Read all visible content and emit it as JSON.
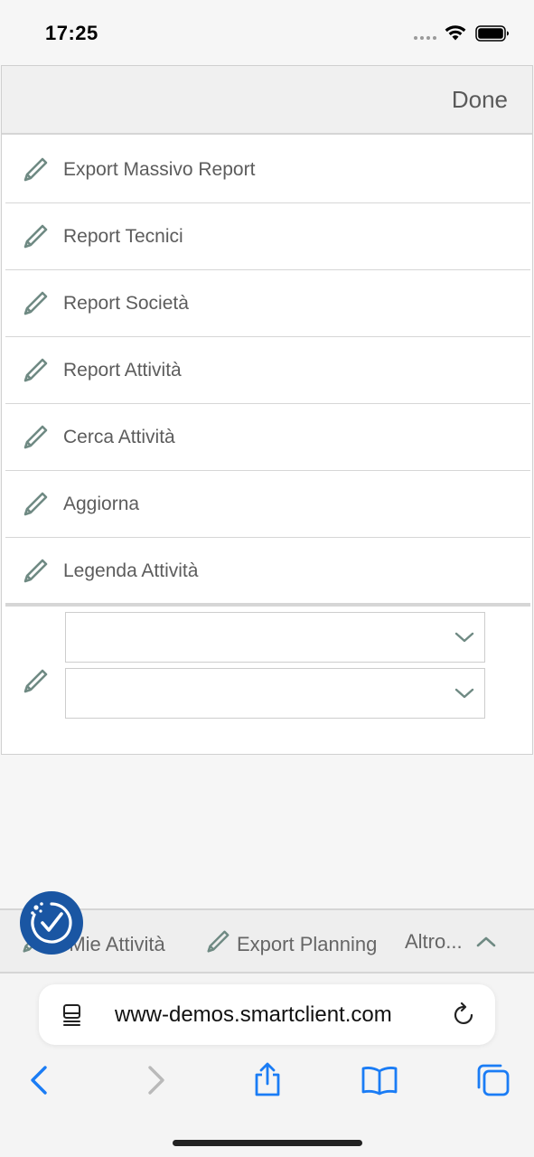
{
  "status_bar": {
    "time": "17:25"
  },
  "panel": {
    "done_label": "Done",
    "items": [
      {
        "label": "Export Massivo Report"
      },
      {
        "label": "Report Tecnici"
      },
      {
        "label": "Report Società"
      },
      {
        "label": "Report Attività"
      },
      {
        "label": "Cerca Attività"
      },
      {
        "label": "Aggiorna"
      },
      {
        "label": "Legenda Attività"
      }
    ],
    "select_one_value": "",
    "select_two_value": ""
  },
  "toolbar": {
    "item_one": "e Mie Attività",
    "item_two": "Export Planning",
    "more_label": "Altro..."
  },
  "browser": {
    "url": "www-demos.smartclient.com"
  },
  "colors": {
    "accent_badge": "#1a56a3",
    "icon_green_gray": "#6f8a83",
    "ios_blue": "#1a7cf5"
  }
}
